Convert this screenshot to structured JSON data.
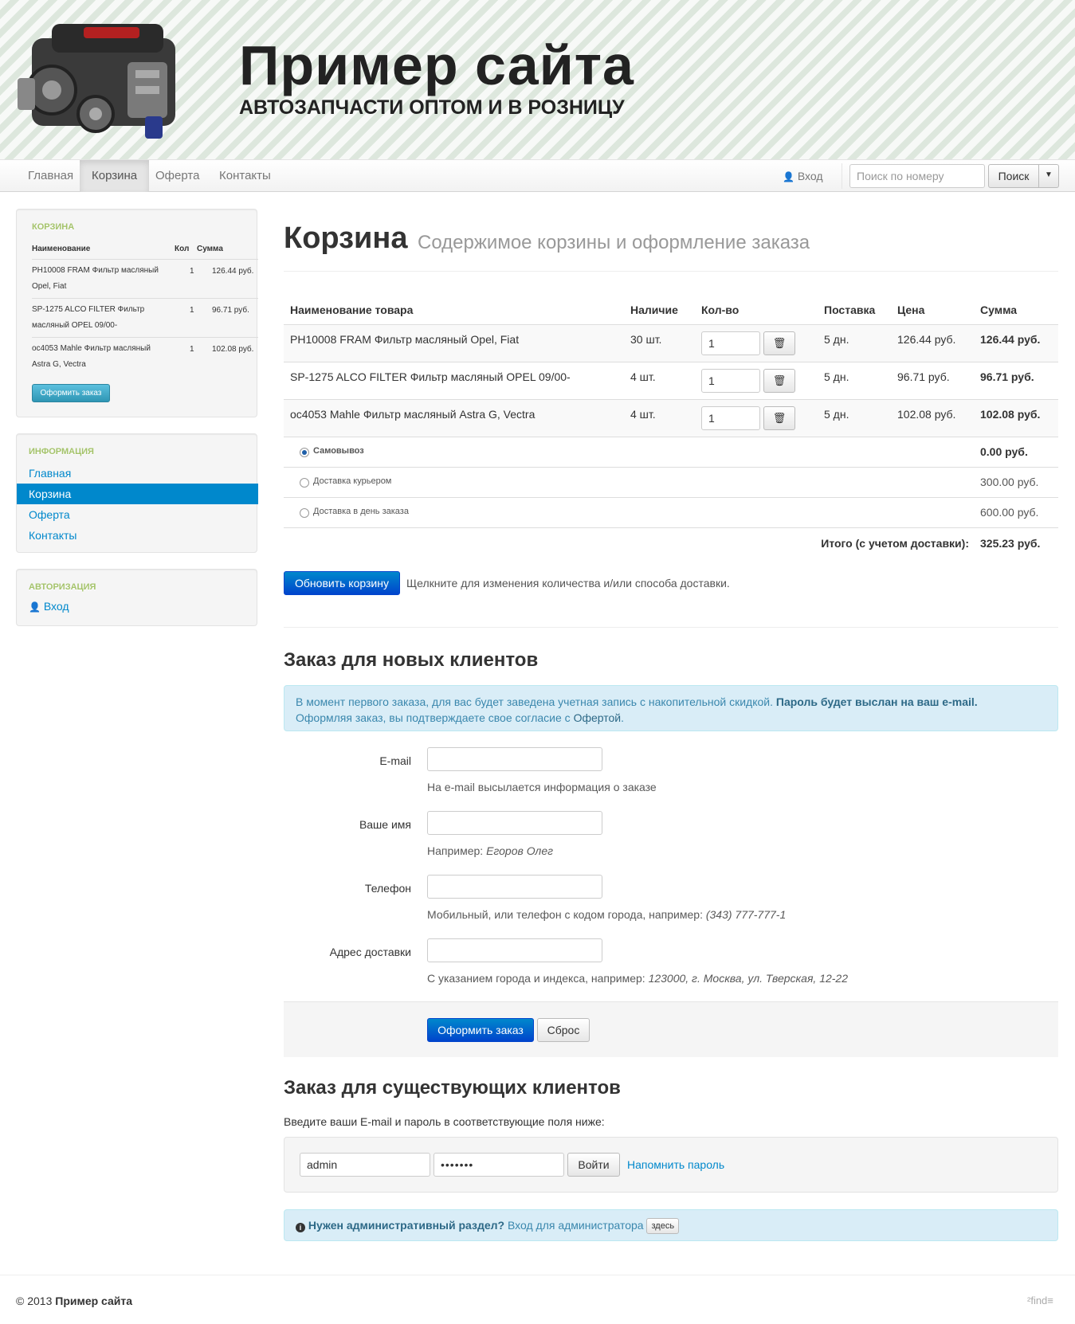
{
  "header": {
    "title": "Пример сайта",
    "subtitle": "АВТОЗАПЧАСТИ ОПТОМ И В РОЗНИЦУ"
  },
  "nav": {
    "items": [
      "Главная",
      "Корзина",
      "Оферта",
      "Контакты"
    ],
    "active": "Корзина",
    "login_label": "Вход",
    "search_placeholder": "Поиск по номеру",
    "search_button": "Поиск"
  },
  "sidebar": {
    "cart": {
      "heading": "КОРЗИНА",
      "columns": [
        "Наименование",
        "Кол",
        "Сумма"
      ],
      "rows": [
        {
          "name": "PH10008 FRAM Фильтр масляный Opel, Fiat",
          "qty": "1",
          "sum": "126.44 руб."
        },
        {
          "name": "SP-1275 ALCO FILTER Фильтр масляный OPEL 09/00-",
          "qty": "1",
          "sum": "96.71 руб."
        },
        {
          "name": "oc4053 Mahle Фильтр масляный Astra G, Vectra",
          "qty": "1",
          "sum": "102.08 руб."
        }
      ],
      "checkout_button": "Оформить заказ"
    },
    "info": {
      "heading": "ИНФОРМАЦИЯ",
      "links": [
        "Главная",
        "Корзина",
        "Оферта",
        "Контакты"
      ]
    },
    "auth": {
      "heading": "АВТОРИЗАЦИЯ",
      "login_link": "Вход"
    }
  },
  "main": {
    "title": "Корзина",
    "subtitle": "Содержимое корзины и оформление заказа",
    "table": {
      "columns": [
        "Наименование товара",
        "Наличие",
        "Кол-во",
        "Поставка",
        "Цена",
        "Сумма"
      ],
      "rows": [
        {
          "name": "PH10008 FRAM Фильтр масляный Opel, Fiat",
          "stock": "30 шт.",
          "qty": "1",
          "delivery": "5 дн.",
          "price": "126.44 руб.",
          "sum": "126.44 руб."
        },
        {
          "name": "SP-1275 ALCO FILTER Фильтр масляный OPEL 09/00-",
          "stock": "4 шт.",
          "qty": "1",
          "delivery": "5 дн.",
          "price": "96.71 руб.",
          "sum": "96.71 руб."
        },
        {
          "name": "oc4053 Mahle Фильтр масляный Astra G, Vectra",
          "stock": "4 шт.",
          "qty": "1",
          "delivery": "5 дн.",
          "price": "102.08 руб.",
          "sum": "102.08 руб."
        }
      ],
      "shipping": [
        {
          "label": "Самовывоз",
          "price": "0.00 руб.",
          "selected": true
        },
        {
          "label": "Доставка курьером",
          "price": "300.00 руб.",
          "selected": false
        },
        {
          "label": "Доставка в день заказа",
          "price": "600.00 руб.",
          "selected": false
        }
      ],
      "total_label": "Итого (с учетом доставки):",
      "total_value": "325.23 руб."
    },
    "update_button": "Обновить корзину",
    "update_hint": "Щелкните для изменения количества и/или способа доставки.",
    "new_clients": {
      "heading": "Заказ для новых клиентов",
      "alert_text1": "В момент первого заказа, для вас будет заведена учетная запись с накопительной скидкой.",
      "alert_bold": "Пароль будет выслан на ваш e-mail.",
      "alert_text2": "Оформляя заказ, вы подтверждаете свое согласие с",
      "alert_link": "Офертой",
      "alert_end": ".",
      "fields": [
        {
          "label": "E-mail",
          "help": "На e-mail высылается информация о заказе",
          "example": ""
        },
        {
          "label": "Ваше имя",
          "help": "Например:",
          "example": "Егоров Олег"
        },
        {
          "label": "Телефон",
          "help": "Мобильный, или телефон с кодом города, например:",
          "example": "(343) 777-777-1"
        },
        {
          "label": "Адрес доставки",
          "help": "С указанием города и индекса, например:",
          "example": "123000, г. Москва, ул. Тверская, 12-22"
        }
      ],
      "submit_button": "Оформить заказ",
      "reset_button": "Сброс"
    },
    "existing_clients": {
      "heading": "Заказ для существующих клиентов",
      "instruction": "Введите ваши E-mail и пароль в соответствующие поля ниже:",
      "email_value": "admin",
      "password_value": "•••••••",
      "login_button": "Войти",
      "remind_link": "Напомнить пароль"
    },
    "admin_alert": {
      "bold": "Нужен административный раздел?",
      "text": "Вход для администратора",
      "button": "здесь"
    }
  },
  "footer": {
    "copyright": "© 2013",
    "site_name": "Пример сайта",
    "logo": "²find≡"
  }
}
